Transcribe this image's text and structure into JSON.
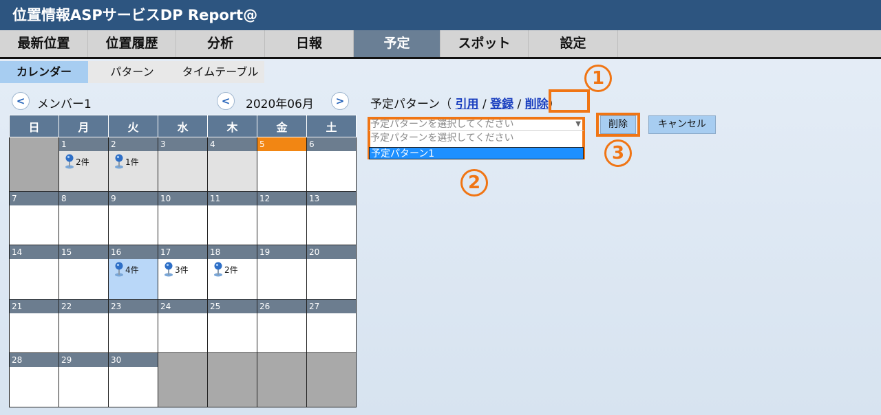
{
  "app_title": "位置情報ASPサービスDP Report@",
  "main_nav": [
    {
      "label": "最新位置"
    },
    {
      "label": "位置履歴"
    },
    {
      "label": "分析"
    },
    {
      "label": "日報"
    },
    {
      "label": "予定",
      "active": true
    },
    {
      "label": "スポット"
    },
    {
      "label": "設定"
    }
  ],
  "sub_nav": [
    {
      "label": "カレンダー",
      "active": true
    },
    {
      "label": "パターン"
    },
    {
      "label": "タイムテーブル"
    }
  ],
  "member": {
    "prev": "<",
    "label": "メンバー1"
  },
  "month": {
    "prev": "<",
    "label": "2020年06月",
    "next": ">"
  },
  "weekdays": [
    "日",
    "月",
    "火",
    "水",
    "木",
    "金",
    "土"
  ],
  "weeks": [
    [
      {
        "day": "",
        "type": "gray"
      },
      {
        "day": "1",
        "type": "light",
        "events": "2件"
      },
      {
        "day": "2",
        "type": "light",
        "events": "1件"
      },
      {
        "day": "3",
        "type": "light"
      },
      {
        "day": "4",
        "type": "light"
      },
      {
        "day": "5",
        "type": "white",
        "today": true
      },
      {
        "day": "6",
        "type": "white"
      }
    ],
    [
      {
        "day": "7",
        "type": "white"
      },
      {
        "day": "8",
        "type": "white"
      },
      {
        "day": "9",
        "type": "white"
      },
      {
        "day": "10",
        "type": "white"
      },
      {
        "day": "11",
        "type": "white"
      },
      {
        "day": "12",
        "type": "white"
      },
      {
        "day": "13",
        "type": "white"
      }
    ],
    [
      {
        "day": "14",
        "type": "white"
      },
      {
        "day": "15",
        "type": "white"
      },
      {
        "day": "16",
        "type": "blue",
        "events": "4件"
      },
      {
        "day": "17",
        "type": "white",
        "events": "3件"
      },
      {
        "day": "18",
        "type": "white",
        "events": "2件"
      },
      {
        "day": "19",
        "type": "white"
      },
      {
        "day": "20",
        "type": "white"
      }
    ],
    [
      {
        "day": "21",
        "type": "white"
      },
      {
        "day": "22",
        "type": "white"
      },
      {
        "day": "23",
        "type": "white"
      },
      {
        "day": "24",
        "type": "white"
      },
      {
        "day": "25",
        "type": "white"
      },
      {
        "day": "26",
        "type": "white"
      },
      {
        "day": "27",
        "type": "white"
      }
    ],
    [
      {
        "day": "28",
        "type": "white"
      },
      {
        "day": "29",
        "type": "white"
      },
      {
        "day": "30",
        "type": "white"
      },
      {
        "day": "",
        "type": "gray"
      },
      {
        "day": "",
        "type": "gray"
      },
      {
        "day": "",
        "type": "gray"
      },
      {
        "day": "",
        "type": "gray"
      }
    ]
  ],
  "pattern_panel": {
    "title": "予定パターン（",
    "link_quote": "引用",
    "sep1": "/",
    "link_register": "登録",
    "sep2": "/",
    "link_delete": "削除",
    "close": "）",
    "select_placeholder": "予定パターンを選択してください",
    "option_placeholder": "予定パターンを選択してください",
    "option_1": "予定パターン1",
    "delete_button": "削除",
    "cancel_button": "キャンセル"
  },
  "markers": {
    "one": "1",
    "two": "2",
    "three": "3"
  },
  "colors": {
    "highlight": "#f07514",
    "titlebar": "#2d5580",
    "active_tab": "#6a7f95",
    "today": "#f28613"
  }
}
